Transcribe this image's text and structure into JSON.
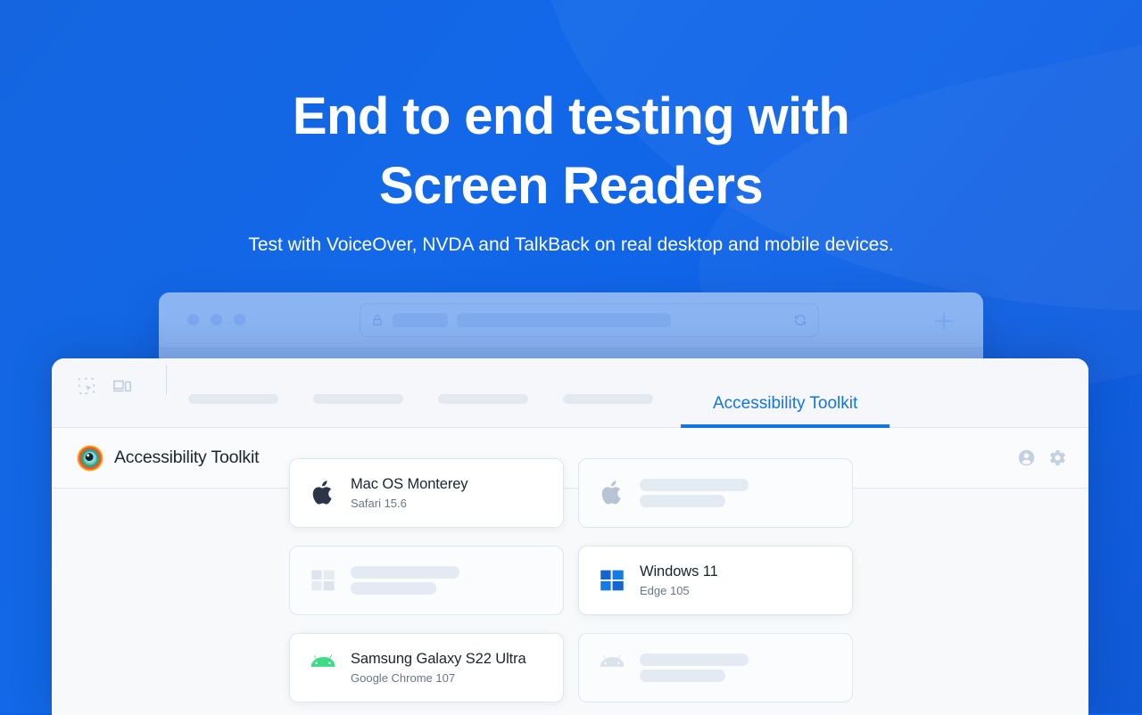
{
  "hero": {
    "headline_line1": "End to end testing with",
    "headline_line2": "Screen Readers",
    "subheadline": "Test with VoiceOver, NVDA and TalkBack on real desktop and mobile devices.",
    "background_color": "#1268e8",
    "text_color": "#ffffff"
  },
  "browser_mock": {
    "traffic_lights": 3,
    "url_bar": {
      "lock_icon": "lock-icon",
      "refresh_icon": "refresh-icon",
      "placeholder_segments": 2
    },
    "new_tab_icon": "plus-icon",
    "chrome_color": "#8ab4f2"
  },
  "app": {
    "toolbar": {
      "inspect_icon": "select-element-icon",
      "device_toggle_icon": "device-toolbar-icon",
      "placeholder_tabs": 4,
      "active_tab": "Accessibility Toolkit",
      "accent_color": "#1575e0"
    },
    "header": {
      "logo_icon": "accessibility-toolkit-logo-icon",
      "title": "Accessibility Toolkit",
      "account_icon": "account-circle-icon",
      "settings_icon": "gear-icon"
    },
    "devices": [
      {
        "icon": "apple-icon",
        "name": "Mac OS Monterey",
        "browser": "Safari 15.6",
        "state": "filled"
      },
      {
        "icon": "apple-icon",
        "name": "",
        "browser": "",
        "state": "ghost"
      },
      {
        "icon": "windows-icon",
        "name": "",
        "browser": "",
        "state": "ghost"
      },
      {
        "icon": "windows-icon",
        "name": "Windows 11",
        "browser": "Edge 105",
        "state": "filled"
      },
      {
        "icon": "android-icon",
        "name": "Samsung Galaxy S22 Ultra",
        "browser": "Google Chrome 107",
        "state": "filled"
      },
      {
        "icon": "android-icon",
        "name": "",
        "browser": "",
        "state": "ghost"
      }
    ]
  }
}
